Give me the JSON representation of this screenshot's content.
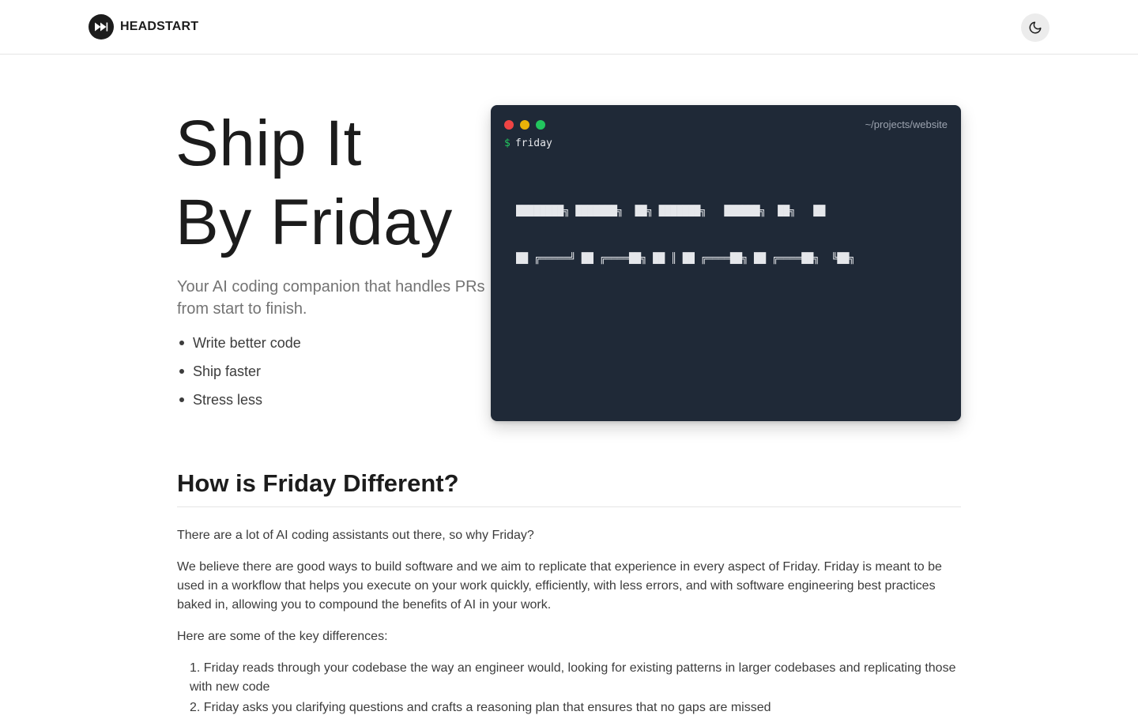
{
  "header": {
    "brand_name": "HEADSTART",
    "logo_icon": "fast-forward-icon",
    "theme_toggle_icon": "moon-icon"
  },
  "hero": {
    "title_line1": "Ship It",
    "title_line2": "By Friday",
    "subtitle": "Your AI coding companion that handles PRs from start to finish.",
    "bullets": [
      "Write better code",
      "Ship faster",
      "Stress less"
    ]
  },
  "terminal": {
    "path": "~/projects/website",
    "prompt_symbol": "$",
    "command": "friday",
    "ascii_art": [
      "████████╗ ███████╗  ██╗ ███████╗   ██████╗  ██╗   ██",
      "██ ╔═════╝ ██ ╔════██╗ ██ ║ ██ ╔════██╗ ██ ╔════██╗  ╚██╗",
      "██████╗   ███████ ╔╝ ██ ║ ██ ║   ██ ║ ████████ ║   ╚████",
      "██ ╔═══╝   ██ ╔════██╗ ██ ║ ██ ║   ██ ║ ██ ╔════██ ║    ╚██ ╔╝",
      "██ ║     ██ ║   ██ ║ ██ ║ ███████ ╔╝ ██ ║   ██ ║    ██ ║",
      " ╚══╝     ╚══╝    ╚══╝ ╚══╝ ╚══════════╝  ╚══╝    ╚══╝    ╚══╝"
    ],
    "dot_colors": [
      "#ef4444",
      "#eab308",
      "#22c55e"
    ]
  },
  "section": {
    "heading": "How is Friday Different?",
    "p1": "There are a lot of AI coding assistants out there, so why Friday?",
    "p2": "We believe there are good ways to build software and we aim to replicate that experience in every aspect of Friday. Friday is meant to be used in a workflow that helps you execute on your work quickly, efficiently, with less errors, and with software engineering best practices baked in, allowing you to compound the benefits of AI in your work.",
    "p3": "Here are some of the key differences:",
    "differences": [
      "1. Friday reads through your codebase the way an engineer would, looking for existing patterns in larger codebases and replicating those with new code",
      "2. Friday asks you clarifying questions and crafts a reasoning plan that ensures that no gaps are missed"
    ]
  }
}
